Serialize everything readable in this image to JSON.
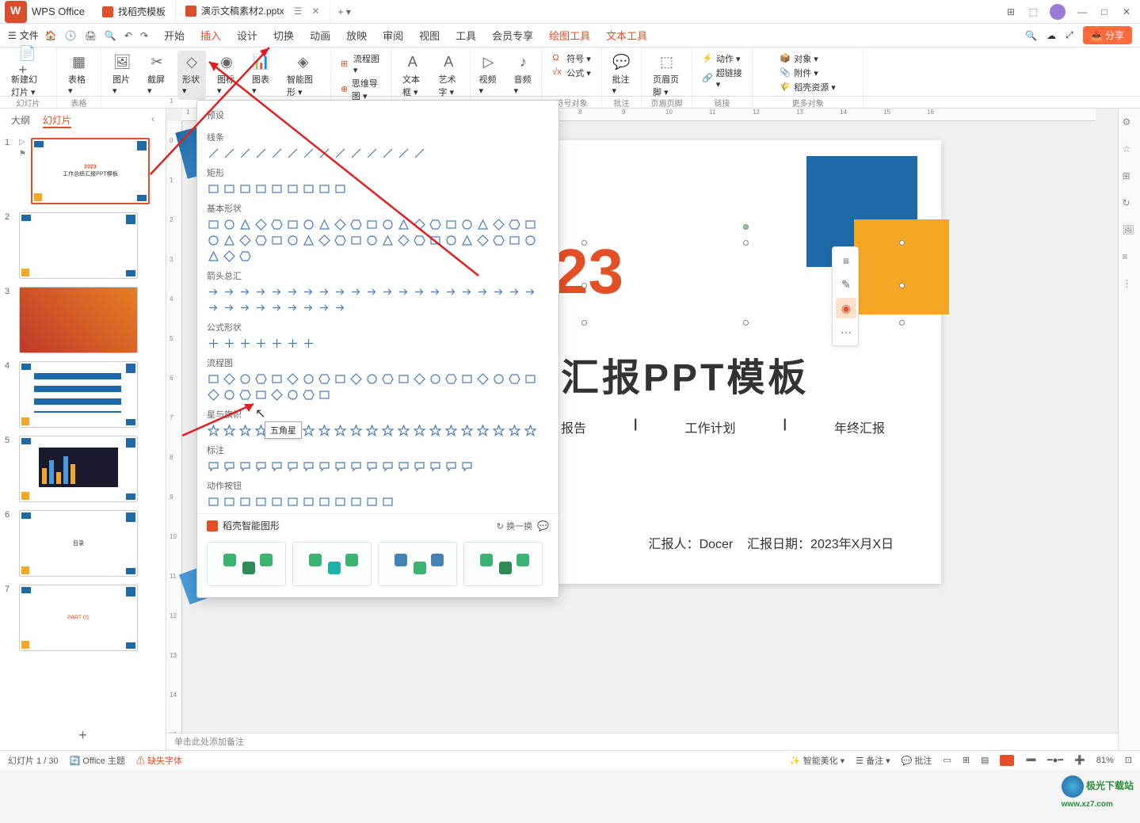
{
  "titlebar": {
    "app_name": "WPS Office",
    "tab1": "找稻壳模板",
    "tab2": "演示文稿素材2.pptx",
    "new_tab": "+",
    "dropdown": "▾"
  },
  "window_controls": {
    "min": "—",
    "max": "□",
    "close": "✕"
  },
  "menubar": {
    "file": "文件",
    "qat": [
      "🏠",
      "🕓",
      "🖨",
      "🔍",
      "↶",
      "↷"
    ],
    "items": [
      "开始",
      "插入",
      "设计",
      "切换",
      "动画",
      "放映",
      "审阅",
      "视图",
      "工具",
      "会员专享",
      "绘图工具",
      "文本工具"
    ],
    "active": "插入",
    "hilite_indices": [
      10,
      11
    ],
    "share": "分享"
  },
  "ribbon": {
    "groups": [
      {
        "label": "幻灯片",
        "btns": [
          {
            "t": "新建幻灯片",
            "ico": "📄+"
          }
        ]
      },
      {
        "label": "表格",
        "btns": [
          {
            "t": "表格",
            "ico": "▦"
          }
        ]
      },
      {
        "label": "",
        "btns": [
          {
            "t": "图片",
            "ico": "🖼"
          },
          {
            "t": "截屏",
            "ico": "✂"
          },
          {
            "t": "形状",
            "ico": "◇",
            "active": true
          },
          {
            "t": "图标",
            "ico": "◉"
          },
          {
            "t": "图表",
            "ico": "📊"
          },
          {
            "t": "智能图形",
            "ico": "◈"
          }
        ]
      },
      {
        "label": "",
        "stacks": [
          {
            "t": "流程图",
            "ico": "⊞"
          },
          {
            "t": "思维导图",
            "ico": "⊕"
          }
        ]
      },
      {
        "label": "",
        "btns": [
          {
            "t": "文本框",
            "ico": "A"
          },
          {
            "t": "艺术字",
            "ico": "A"
          }
        ]
      },
      {
        "label": "",
        "btns": [
          {
            "t": "视频",
            "ico": "▷"
          },
          {
            "t": "音频",
            "ico": "♪"
          }
        ]
      },
      {
        "label": "符号对象",
        "stacks": [
          {
            "t": "符号",
            "ico": "Ω"
          },
          {
            "t": "公式",
            "ico": "√x"
          }
        ]
      },
      {
        "label": "批注",
        "btns": [
          {
            "t": "批注",
            "ico": "💬"
          }
        ]
      },
      {
        "label": "页眉页脚",
        "btns": [
          {
            "t": "页眉页脚",
            "ico": "⬚"
          }
        ]
      },
      {
        "label": "链接",
        "stacks": [
          {
            "t": "动作",
            "ico": "⚡"
          },
          {
            "t": "超链接",
            "ico": "🔗"
          }
        ]
      },
      {
        "label": "更多对象",
        "stacks": [
          {
            "t": "对象",
            "ico": "📦"
          },
          {
            "t": "附件",
            "ico": "📎"
          },
          {
            "t": "稻壳资源",
            "ico": "🌾"
          }
        ]
      }
    ]
  },
  "thumb_tabs": {
    "outline": "大纲",
    "slides": "幻灯片"
  },
  "slides": [
    {
      "n": "1",
      "title": "2023",
      "sub": "工作总结汇报PPT模板"
    },
    {
      "n": "2"
    },
    {
      "n": "3"
    },
    {
      "n": "4"
    },
    {
      "n": "5"
    },
    {
      "n": "6",
      "title": "目录"
    },
    {
      "n": "7",
      "title": "PART 01"
    }
  ],
  "shapes_panel": {
    "preset": "预设",
    "lines": "线条",
    "rect": "矩形",
    "basic": "基本形状",
    "arrows": "箭头总汇",
    "formula": "公式形状",
    "flow": "流程图",
    "stars": "星与旗帜",
    "callout": "标注",
    "actions": "动作按钮",
    "smart": "稻壳智能图形",
    "refresh": "换一换",
    "tooltip": "五角星",
    "counts": {
      "lines": 14,
      "rect": 9,
      "basic": 45,
      "arrows": 30,
      "formula": 7,
      "flow": 29,
      "stars": 21,
      "callout": 17,
      "actions": 12
    }
  },
  "canvas": {
    "year": "23",
    "title_tail": "汇报PPT模板",
    "sub_items": [
      "报告",
      "工作计划",
      "年终汇报"
    ],
    "sep": "|",
    "footer_reporter_label": "汇报人：",
    "footer_reporter": "Docer",
    "footer_date_label": "汇报日期：",
    "footer_date": "2023年X月X日",
    "notes_placeholder": "单击此处添加备注"
  },
  "statusbar": {
    "slide_info": "幻灯片 1 / 30",
    "theme": "Office 主题",
    "missing_font": "缺失字体",
    "smart_beautify": "智能美化",
    "notes": "备注",
    "comments": "批注",
    "zoom": "81%"
  },
  "colors": {
    "accent": "#e34f26",
    "blue": "#1e6aa8",
    "orange": "#f5a623",
    "shape": "#4a7ab8",
    "annotation": "#e02020"
  },
  "watermark": {
    "site": "极光下载站",
    "url": "www.xz7.com"
  }
}
